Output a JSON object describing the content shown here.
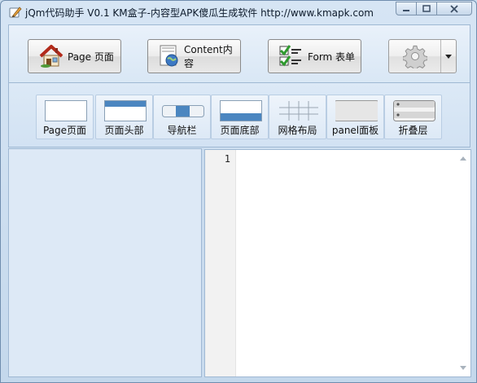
{
  "window": {
    "title": "jQm代码助手 V0.1  KM盒子-内容型APK傻瓜生成软件 http://www.kmapk.com",
    "controls": [
      "minimize",
      "maximize",
      "close"
    ]
  },
  "toolbar": {
    "buttons": [
      {
        "label": "Page 页面",
        "icon": "house-icon"
      },
      {
        "label": "Content内容",
        "icon": "document-globe-icon"
      },
      {
        "label": "Form 表单",
        "icon": "checklist-icon"
      }
    ],
    "settings_icon": "gear-icon",
    "dropdown_icon": "chevron-down-icon"
  },
  "components": [
    {
      "label": "Page页面",
      "preview": "page"
    },
    {
      "label": "页面头部",
      "preview": "header"
    },
    {
      "label": "导航栏",
      "preview": "navbar"
    },
    {
      "label": "页面底部",
      "preview": "footer"
    },
    {
      "label": "网格布局",
      "preview": "grid"
    },
    {
      "label": "panel面板",
      "preview": "panel"
    },
    {
      "label": "折叠层",
      "preview": "collapsible"
    }
  ],
  "editor": {
    "line_numbers": [
      "1"
    ],
    "content": ""
  },
  "colors": {
    "accent": "#4b86c0",
    "window_bg": "#d6e5f4",
    "border": "#9fb8d3"
  }
}
